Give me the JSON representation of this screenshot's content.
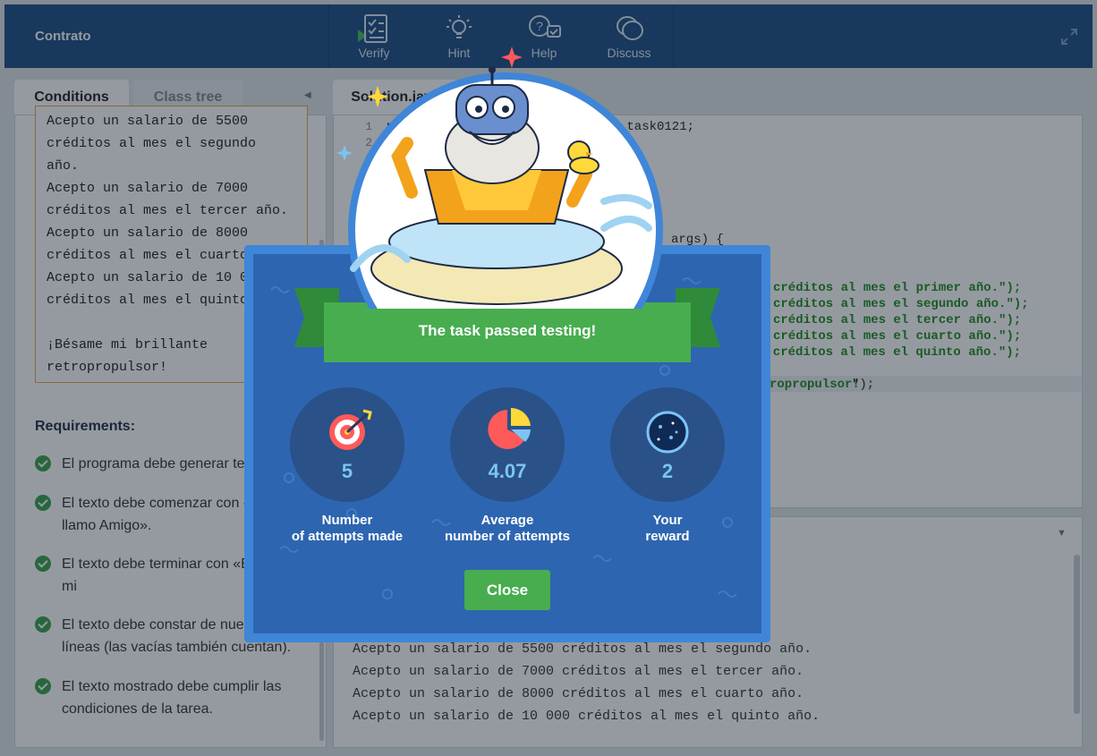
{
  "app": {
    "title": "Contrato"
  },
  "toolbar": {
    "verify": "Verify",
    "hint": "Hint",
    "help": "Help",
    "discuss": "Discuss"
  },
  "left_tabs": {
    "conditions": "Conditions",
    "class_tree": "Class tree"
  },
  "conditions": {
    "text": "Acepto un salario de 5500\ncréditos al mes el segundo\naño.\nAcepto un salario de 7000\ncréditos al mes el tercer año.\nAcepto un salario de 8000\ncréditos al mes el cuarto año.\nAcepto un salario de 10 000\ncréditos al mes el quinto año.\n\n¡Bésame mi brillante\nretropropulsor!"
  },
  "requirements": {
    "title": "Requirements:",
    "items": [
      "El programa debe generar texto.",
      "El texto debe comenzar con «Me\nllamo Amigo».",
      "El texto debe terminar con «Bésame mi\nretropropulsor!».",
      "El texto debe constar de nueve\nlíneas (las vacías también cuentan).",
      "El texto mostrado debe cumplir las\ncondiciones de la tarea."
    ]
  },
  "editor": {
    "tab": "Solution.java",
    "line_numbers": "1\n2\n3",
    "line1_kw": "pa",
    "line1_pkg": ".task0121;",
    "args": "args) {",
    "strings": [
      "créditos al mes el primer año.\");",
      "créditos al mes el segundo año.\");",
      "créditos al mes el tercer año.\");",
      "créditos al mes el cuarto año.\");",
      "0 créditos al mes el quinto año.\");"
    ],
    "last_str": "ropropulsor!",
    "last_tail": "\");"
  },
  "output": {
    "lines": [
      "o.",
      "Acepto un salario de 5500 créditos al mes el segundo año.",
      "Acepto un salario de 7000 créditos al mes el tercer año.",
      "Acepto un salario de 8000 créditos al mes el cuarto año.",
      "Acepto un salario de 10 000 créditos al mes el quinto año."
    ]
  },
  "modal": {
    "title": "The task passed testing!",
    "stats": [
      {
        "value": "5",
        "label": "Number\nof attempts made",
        "icon": "target-icon"
      },
      {
        "value": "4.07",
        "label": "Average\nnumber of attempts",
        "icon": "pie-chart-icon"
      },
      {
        "value": "2",
        "label": "Your\nreward",
        "icon": "dark-matter-icon"
      }
    ],
    "close": "Close"
  },
  "colors": {
    "header": "#1d4e85",
    "modal": "#2e65b0",
    "success": "#47ad4f",
    "stat_value": "#7cc4f5",
    "code_string": "#1f8b1f"
  }
}
